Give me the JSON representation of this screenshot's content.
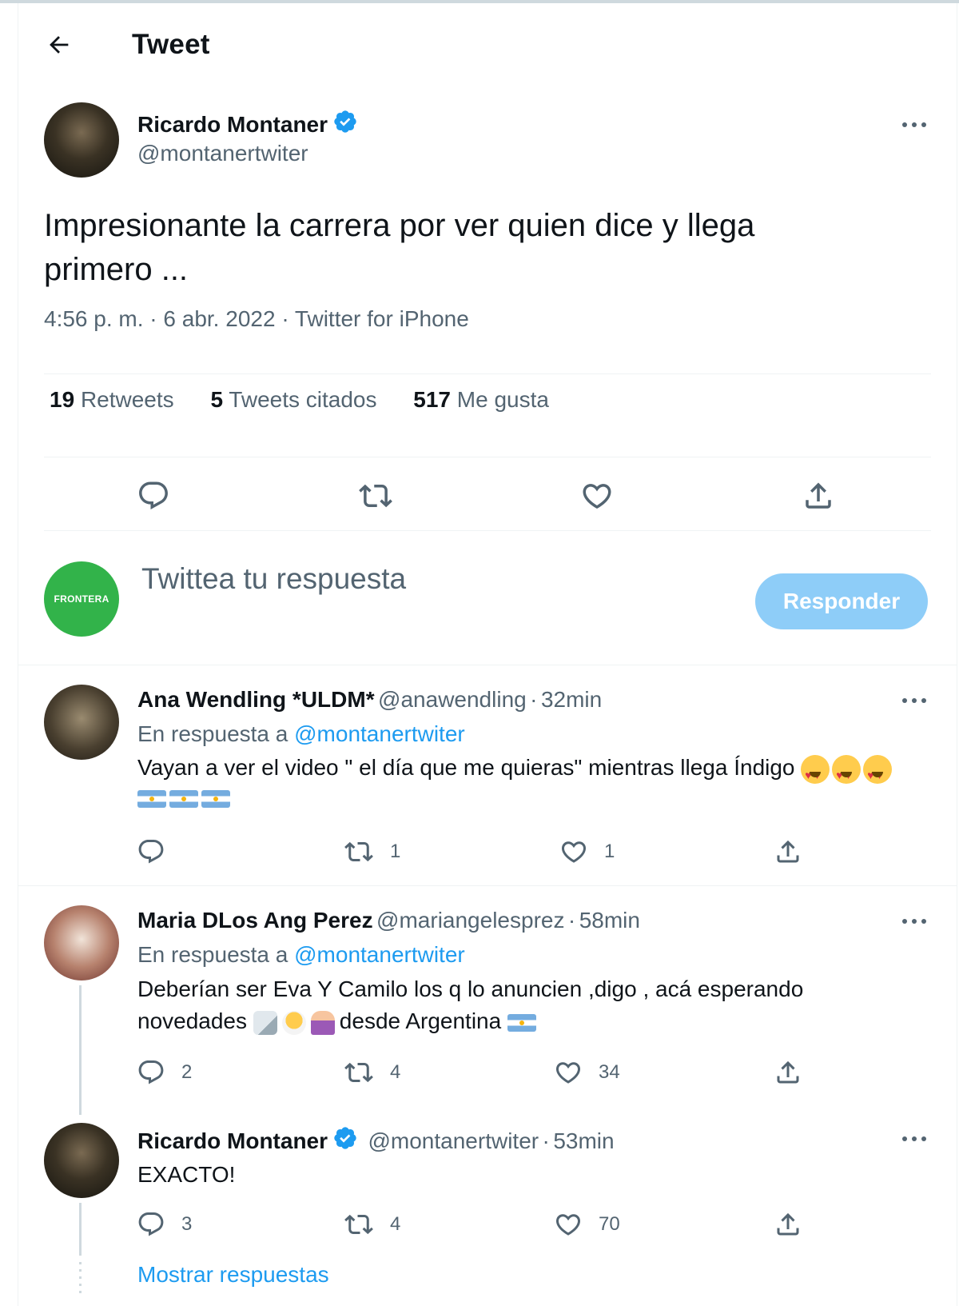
{
  "header": {
    "title": "Tweet"
  },
  "main_tweet": {
    "author_name": "Ricardo Montaner",
    "author_handle": "@montanertwiter",
    "text_line1": "Impresionante la carrera por ver quien dice y llega",
    "text_line2": "primero ...",
    "time": "4:56 p. m.",
    "date": "6 abr. 2022",
    "source": "Twitter for iPhone",
    "separator": "·",
    "stats": {
      "retweets_count": "19",
      "retweets_label": "Retweets",
      "quotes_count": "5",
      "quotes_label": "Tweets citados",
      "likes_count": "517",
      "likes_label": "Me gusta"
    }
  },
  "composer": {
    "avatar_text": "FRONTERA",
    "placeholder": "Twittea tu respuesta",
    "reply_button": "Responder"
  },
  "replies": [
    {
      "author_name": "Ana Wendling *ULDM*",
      "author_handle": "@anawendling",
      "time": "32min",
      "reply_prefix": "En respuesta a",
      "reply_to": "@montanertwiter",
      "text": "Vayan a ver el video \" el día que me quieras\" mientras llega Índigo",
      "replies_count": "",
      "retweets_count": "1",
      "likes_count": "1"
    },
    {
      "author_name": "Maria DLos Ang Perez",
      "author_handle": "@mariangelesprez",
      "time": "58min",
      "reply_prefix": "En respuesta a",
      "reply_to": "@montanertwiter",
      "text_line1": "Deberían ser Eva Y Camilo los q lo anuncien ,digo , acá esperando",
      "text_line2a": "novedades",
      "text_line2b": "desde Argentina",
      "replies_count": "2",
      "retweets_count": "4",
      "likes_count": "34"
    },
    {
      "author_name": "Ricardo Montaner",
      "author_handle": "@montanertwiter",
      "time": "53min",
      "text": "EXACTO!",
      "replies_count": "3",
      "retweets_count": "4",
      "likes_count": "70"
    }
  ],
  "show_replies": "Mostrar respuestas",
  "colors": {
    "accent": "#1d9bf0",
    "reply_button_disabled": "#8ecdf8",
    "secondary_text": "#536471",
    "frontera_green": "#32b34a"
  },
  "icons": [
    "back-arrow-icon",
    "verified-badge-icon",
    "more-icon",
    "reply-icon",
    "retweet-icon",
    "like-icon",
    "share-icon",
    "emoji-heart-eyes",
    "flag-argentina",
    "emoji-baby-bottle",
    "emoji-hatching-chick",
    "emoji-baby"
  ]
}
